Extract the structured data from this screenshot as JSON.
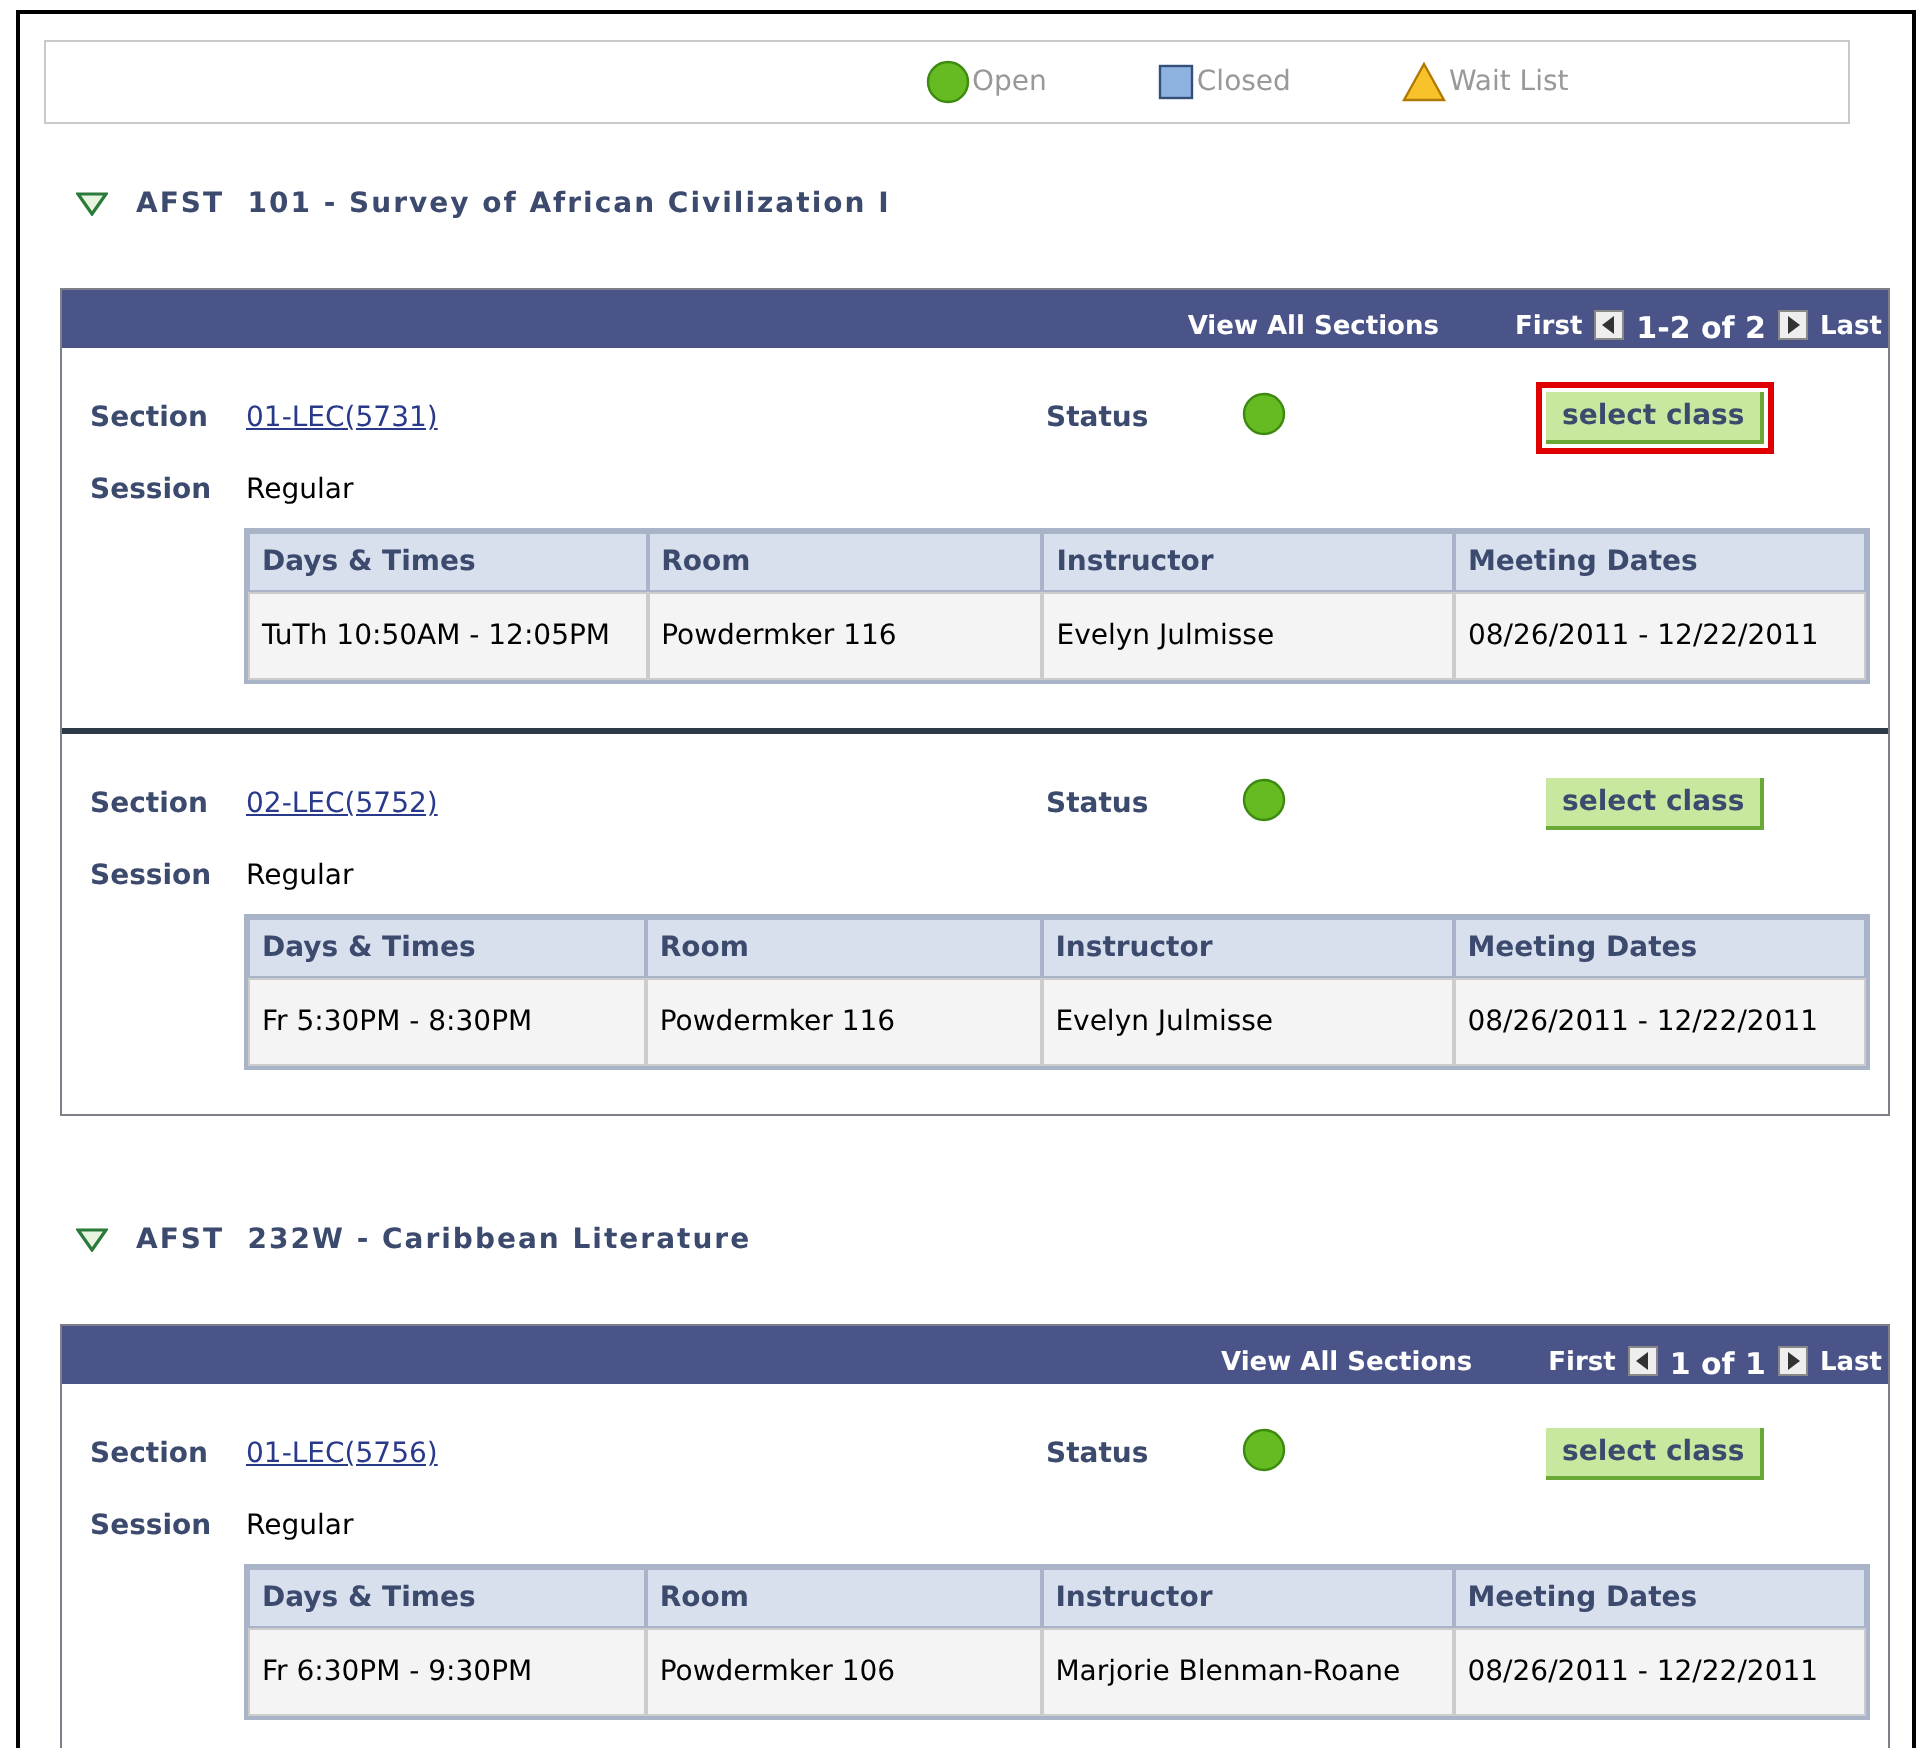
{
  "legend": [
    {
      "kind": "open",
      "label": "Open"
    },
    {
      "kind": "closed",
      "label": "Closed"
    },
    {
      "kind": "waitlist",
      "label": "Wait List"
    }
  ],
  "courses": [
    {
      "expanded": true,
      "title": "AFST  101 - Survey of African Civilization I",
      "view_all": "View All Sections",
      "first": "First",
      "range": "1-2 of 2",
      "last": "Last",
      "sections": [
        {
          "section_label": "Section",
          "section": "01-LEC(5731)",
          "status_label": "Status",
          "kind": "open",
          "button": "select class",
          "highlighted": true,
          "session_label": "Session",
          "session": "Regular",
          "columns": [
            "Days & Times",
            "Room",
            "Instructor",
            "Meeting Dates"
          ],
          "cells": [
            "TuTh 10:50AM - 12:05PM",
            "Powdermker 116",
            "Evelyn Julmisse",
            "08/26/2011 - 12/22/2011"
          ]
        },
        {
          "section_label": "Section",
          "section": "02-LEC(5752)",
          "status_label": "Status",
          "kind": "open",
          "button": "select class",
          "highlighted": false,
          "session_label": "Session",
          "session": "Regular",
          "columns": [
            "Days & Times",
            "Room",
            "Instructor",
            "Meeting Dates"
          ],
          "cells": [
            "Fr 5:30PM - 8:30PM",
            "Powdermker 116",
            "Evelyn Julmisse",
            "08/26/2011 - 12/22/2011"
          ]
        }
      ]
    },
    {
      "expanded": true,
      "title": "AFST  232W - Caribbean Literature",
      "view_all": "View All Sections",
      "first": "First",
      "range": "1 of 1",
      "last": "Last",
      "sections": [
        {
          "section_label": "Section",
          "section": "01-LEC(5756)",
          "status_label": "Status",
          "kind": "open",
          "button": "select class",
          "highlighted": false,
          "session_label": "Session",
          "session": "Regular",
          "columns": [
            "Days & Times",
            "Room",
            "Instructor",
            "Meeting Dates"
          ],
          "cells": [
            "Fr 6:30PM - 9:30PM",
            "Powdermker 106",
            "Marjorie Blenman-Roane",
            "08/26/2011 - 12/22/2011"
          ]
        }
      ]
    }
  ]
}
